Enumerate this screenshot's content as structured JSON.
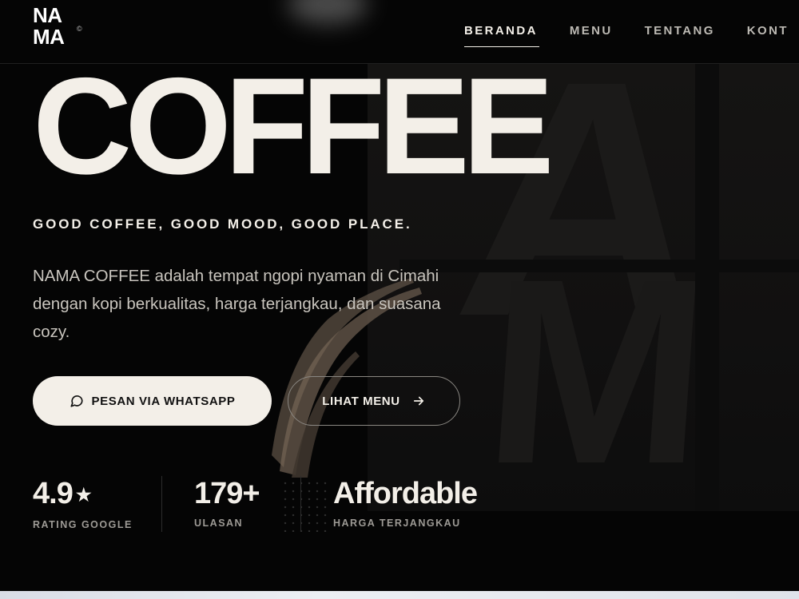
{
  "brand": {
    "logo_line1": "NA",
    "logo_line2": "MA",
    "logo_mark": "©"
  },
  "nav": {
    "items": [
      {
        "label": "BERANDA",
        "active": true
      },
      {
        "label": "MENU",
        "active": false
      },
      {
        "label": "TENTANG",
        "active": false
      },
      {
        "label": "KONT",
        "active": false
      }
    ]
  },
  "hero": {
    "title": "COFFEE",
    "tagline": "GOOD COFFEE, GOOD MOOD, GOOD PLACE.",
    "description": "NAMA COFFEE adalah tempat ngopi nyaman di Cimahi dengan kopi berkualitas, harga terjangkau, dan suasana cozy.",
    "primary_button": {
      "label": "PESAN VIA WHATSAPP",
      "icon": "chat-bubble-icon"
    },
    "secondary_button": {
      "label": "LIHAT MENU",
      "icon": "arrow-right-icon"
    }
  },
  "stats": [
    {
      "value": "4.9",
      "suffix": "★",
      "label": "RATING GOOGLE"
    },
    {
      "value": "179+",
      "label": "ULASAN"
    },
    {
      "value": "Affordable",
      "label": "HARGA TERJANGKAU"
    }
  ],
  "colors": {
    "background": "#050505",
    "cream": "#f3efe8",
    "muted": "#9d9a95"
  }
}
